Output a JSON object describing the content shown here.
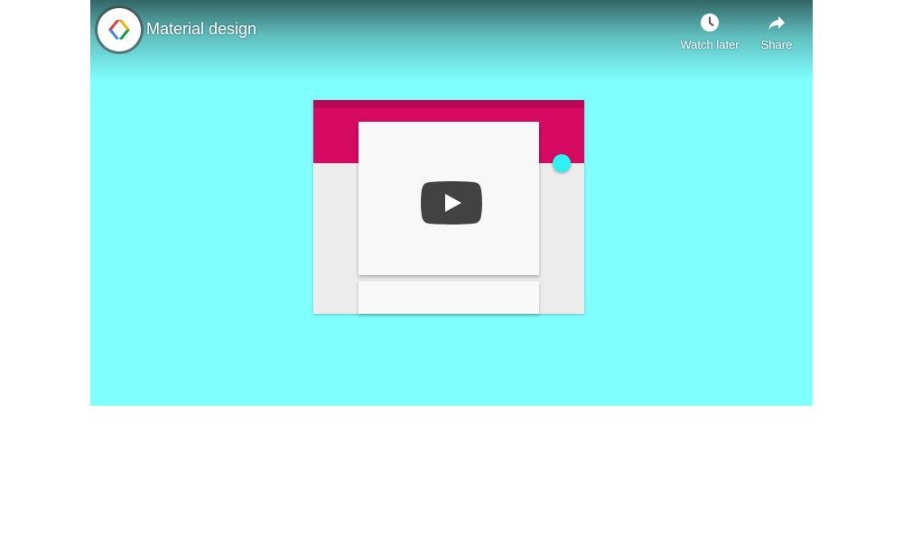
{
  "video": {
    "title": "Material design",
    "background_color": "#80ffff"
  },
  "channel": {
    "avatar_icon": "chrome-developers-logo-icon"
  },
  "actions": {
    "watch_later_label": "Watch later",
    "watch_later_icon": "clock-icon",
    "share_label": "Share",
    "share_icon": "share-arrow-icon"
  },
  "play_button": {
    "icon": "youtube-play-icon",
    "color": "#424242"
  },
  "thumbnail": {
    "appbar_color": "#d60a62",
    "statusbar_color": "#bd0752",
    "fab_color": "#2ef2f2",
    "surface_color": "#ececec",
    "card_color": "#f8f8f8"
  }
}
